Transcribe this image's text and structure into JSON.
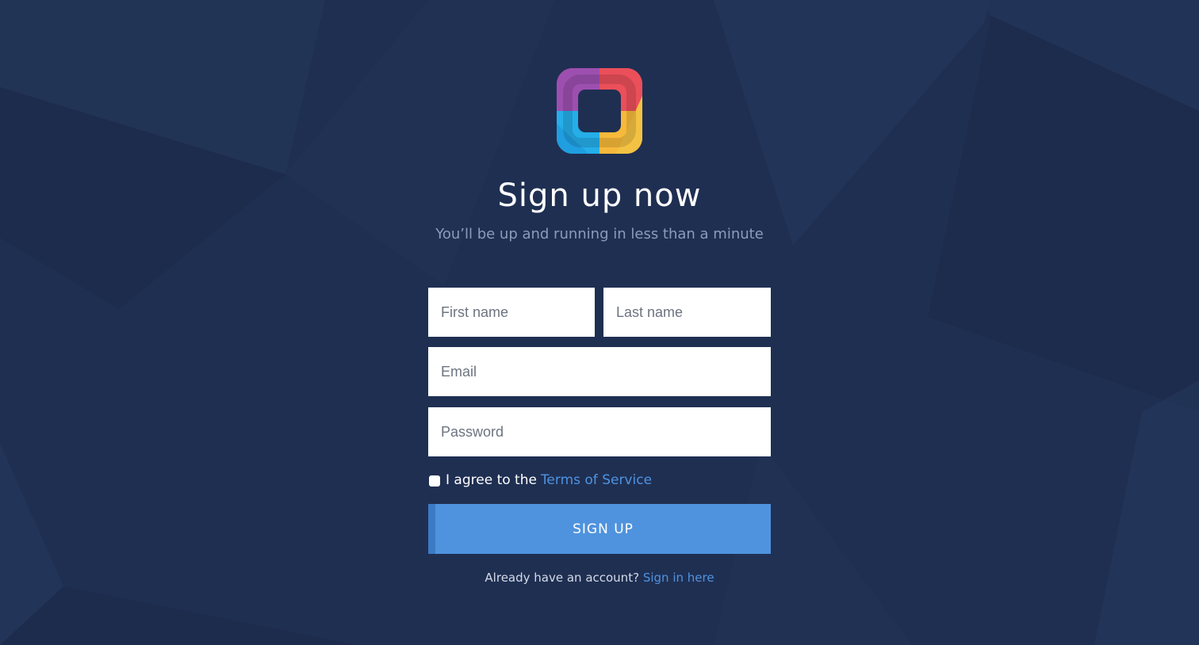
{
  "page": {
    "title": "Sign up now",
    "subtitle": "You’ll be up and running in less than a minute"
  },
  "logo": {
    "icon": "app-logo-icon"
  },
  "form": {
    "first_name_placeholder": "First name",
    "last_name_placeholder": "Last name",
    "email_placeholder": "Email",
    "password_placeholder": "Password",
    "terms_text": "I agree to the",
    "terms_link": "Terms of Service",
    "submit_label": "SIGN UP"
  },
  "footer": {
    "text": "Already have an account?",
    "link": "Sign in here"
  },
  "colors": {
    "background": "#1f2f52",
    "accent": "#4f93de",
    "link": "#4f93e0"
  }
}
